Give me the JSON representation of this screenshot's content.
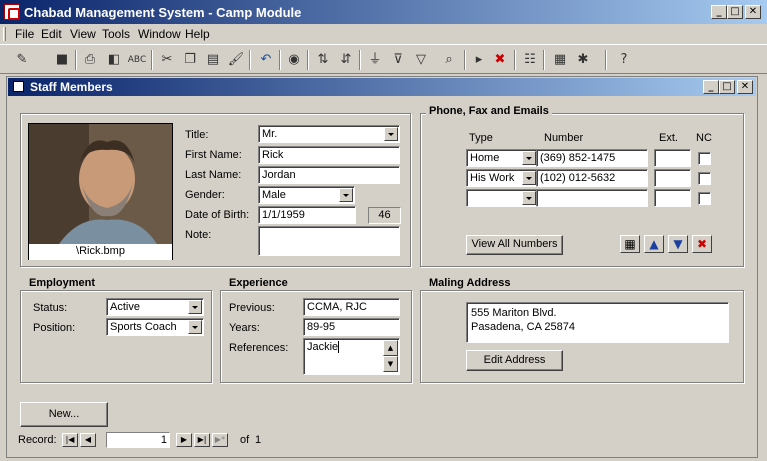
{
  "app": {
    "title": "Chabad Management System - Camp Module"
  },
  "window_controls": {
    "minimize": "_",
    "maximize": "□",
    "close": "✕"
  },
  "menu": [
    "File",
    "Edit",
    "View",
    "Tools",
    "Window",
    "Help"
  ],
  "toolbar": {
    "icons": [
      "design-view-icon",
      "save-icon",
      "print-icon",
      "print-preview-icon",
      "spelling-icon",
      "cut-icon",
      "copy-icon",
      "paste-icon",
      "format-painter-icon",
      "undo-icon",
      "hyperlink-icon",
      "sort-ascending-icon",
      "sort-descending-icon",
      "filter-by-selection-icon",
      "filter-by-form-icon",
      "apply-filter-icon",
      "find-icon",
      "new-record-icon",
      "delete-record-icon",
      "properties-icon",
      "database-window-icon",
      "new-object-icon",
      "help-icon"
    ]
  },
  "form": {
    "title": "Staff Members",
    "photo_caption": "\\Rick.bmp",
    "labels": {
      "title": "Title:",
      "first_name": "First Name:",
      "last_name": "Last Name:",
      "gender": "Gender:",
      "dob": "Date of Birth:",
      "note": "Note:"
    },
    "values": {
      "title": "Mr.",
      "first_name": "Rick",
      "last_name": "Jordan",
      "gender": "Male",
      "dob": "1/1/1959",
      "age": "46",
      "note": ""
    }
  },
  "phones": {
    "title": "Phone, Fax and Emails",
    "headers": {
      "type": "Type",
      "number": "Number",
      "ext": "Ext.",
      "nc": "NC"
    },
    "rows": [
      {
        "type": "Home",
        "number": "(369) 852-1475",
        "ext": ""
      },
      {
        "type": "His Work",
        "number": "(102) 012-5632",
        "ext": ""
      },
      {
        "type": "",
        "number": "",
        "ext": ""
      }
    ],
    "view_all_label": "View All Numbers"
  },
  "employment": {
    "title": "Employment",
    "status_label": "Status:",
    "status": "Active",
    "position_label": "Position:",
    "position": "Sports Coach"
  },
  "experience": {
    "title": "Experience",
    "previous_label": "Previous:",
    "previous": "CCMA, RJC",
    "years_label": "Years:",
    "years": "89-95",
    "references_label": "References:",
    "references": "Jackie"
  },
  "address": {
    "title": "Maling Address",
    "line1": "555 Mariton Blvd.",
    "line2": "Pasadena, CA 25874",
    "edit_label": "Edit Address"
  },
  "new_button": "New...",
  "record_nav": {
    "label": "Record:",
    "current": "1",
    "of_label": "of",
    "total": "1"
  }
}
